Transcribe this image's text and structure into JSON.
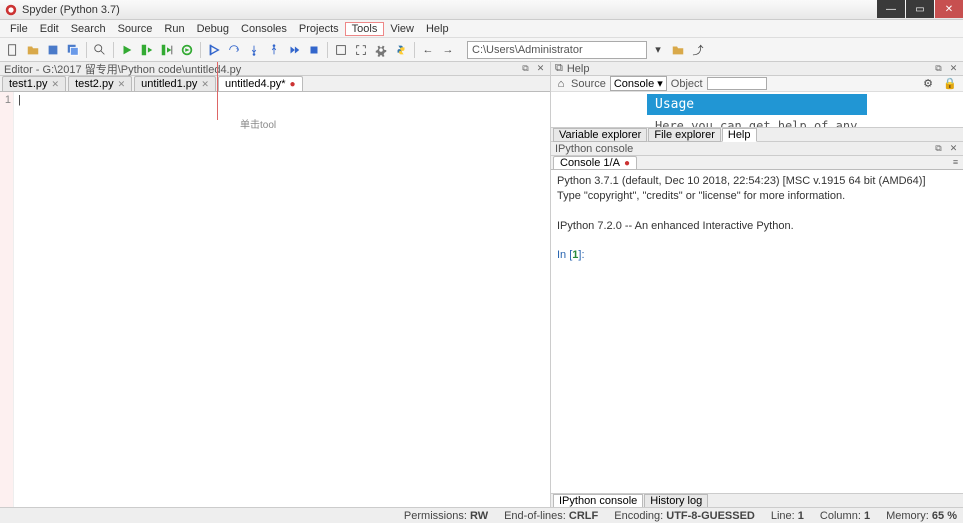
{
  "titlebar": {
    "text": "Spyder (Python 3.7)"
  },
  "menu": {
    "items": [
      "File",
      "Edit",
      "Search",
      "Source",
      "Run",
      "Debug",
      "Consoles",
      "Projects",
      "Tools",
      "View",
      "Help"
    ]
  },
  "toolbar": {
    "location": "C:\\Users\\Administrator"
  },
  "editor": {
    "header": "Editor - G:\\2017 留专用\\Python code\\untitled4.py",
    "tabs": [
      {
        "label": "test1.py"
      },
      {
        "label": "test2.py"
      },
      {
        "label": "untitled1.py"
      },
      {
        "label": "untitled4.py*",
        "active": true
      }
    ],
    "line_number": "1",
    "annotation": "单击tool"
  },
  "help": {
    "header": "Help",
    "source_label": "Source",
    "source_value": "Console",
    "object_label": "Object",
    "usage_title": "Usage",
    "usage_text": "Here you can get help of any",
    "bottom_tabs": [
      "Variable explorer",
      "File explorer",
      "Help"
    ]
  },
  "console": {
    "header": "IPython console",
    "tab": "Console 1/A",
    "text_line1": "Python 3.7.1 (default, Dec 10 2018, 22:54:23) [MSC v.1915 64 bit (AMD64)]",
    "text_line2": "Type \"copyright\", \"credits\" or \"license\" for more information.",
    "text_line3": "IPython 7.2.0 -- An enhanced Interactive Python.",
    "prompt_in": "In [",
    "prompt_num": "1",
    "prompt_close": "]:",
    "bottom_tabs": [
      "IPython console",
      "History log"
    ]
  },
  "status": {
    "permissions_label": "Permissions:",
    "permissions_value": "RW",
    "eol_label": "End-of-lines:",
    "eol_value": "CRLF",
    "encoding_label": "Encoding:",
    "encoding_value": "UTF-8-GUESSED",
    "line_label": "Line:",
    "line_value": "1",
    "column_label": "Column:",
    "column_value": "1",
    "memory_label": "Memory:",
    "memory_value": "65 %"
  }
}
